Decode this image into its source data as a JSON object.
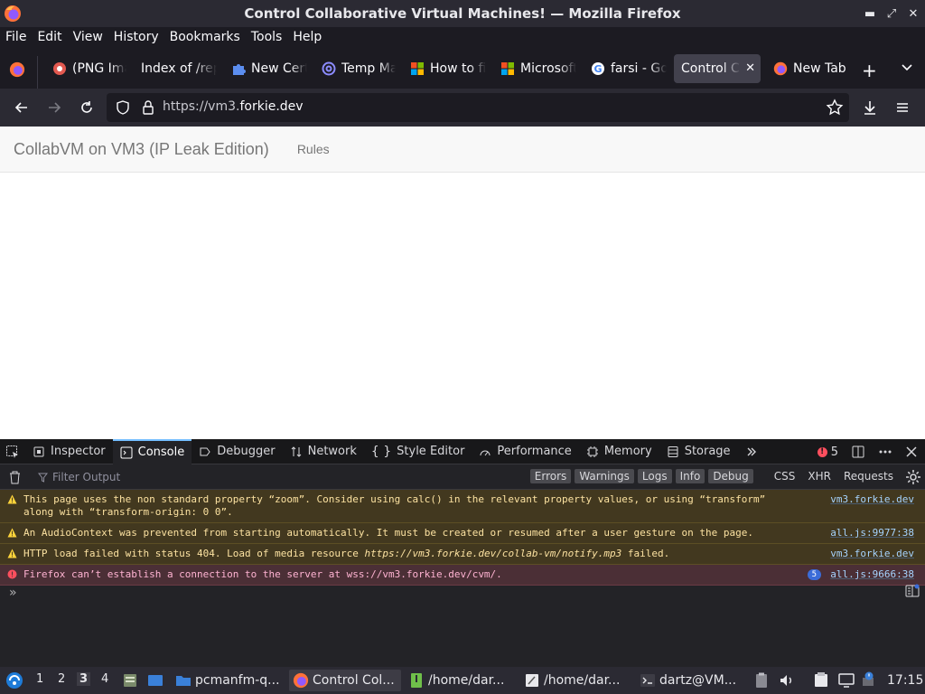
{
  "window": {
    "title": "Control Collaborative Virtual Machines! — Mozilla Firefox"
  },
  "menubar": {
    "items": [
      "File",
      "Edit",
      "View",
      "History",
      "Bookmarks",
      "Tools",
      "Help"
    ]
  },
  "tabs": [
    {
      "label": "(PNG Image",
      "icon": "png-icon"
    },
    {
      "label": "Index of /rep",
      "icon": "none"
    },
    {
      "label": "New Certificate",
      "icon": "puzzle-icon"
    },
    {
      "label": "Temp Mail",
      "icon": "at-icon"
    },
    {
      "label": "How to fix",
      "icon": "windows-icon"
    },
    {
      "label": "Microsoft",
      "icon": "microsoft-icon"
    },
    {
      "label": "farsi - Google",
      "icon": "google-icon"
    },
    {
      "label": "Control Collaborative",
      "icon": "none",
      "active": true
    },
    {
      "label": "New Tab",
      "icon": "firefox-icon"
    }
  ],
  "navbar": {
    "url_prefix": "https://vm3.",
    "url_domain": "forkie.dev"
  },
  "page": {
    "brand": "CollabVM on VM3 (IP Leak Edition)",
    "nav_rules": "Rules"
  },
  "devtools": {
    "tabs": [
      "Inspector",
      "Console",
      "Debugger",
      "Network",
      "Style Editor",
      "Performance",
      "Memory",
      "Storage"
    ],
    "active_tab": "Console",
    "error_count": "5",
    "filter_placeholder": "Filter Output",
    "filters": [
      "Errors",
      "Warnings",
      "Logs",
      "Info",
      "Debug"
    ],
    "filters_extra": [
      "CSS",
      "XHR",
      "Requests"
    ],
    "messages": [
      {
        "level": "warning",
        "text": "This page uses the non standard property “zoom”. Consider using calc() in the relevant property values, or using “transform” along with “transform-origin: 0 0”.",
        "source": "vm3.forkie.dev"
      },
      {
        "level": "warning",
        "text": "An AudioContext was prevented from starting automatically. It must be created or resumed after a user gesture on the page.",
        "source": "all.js:9977:38"
      },
      {
        "level": "warning",
        "text_before": "HTTP load failed with status 404. Load of media resource ",
        "text_link": "https://vm3.forkie.dev/collab-vm/notify.mp3",
        "text_after": " failed.",
        "source": "vm3.forkie.dev"
      },
      {
        "level": "error",
        "text": "Firefox can’t establish a connection to the server at wss://vm3.forkie.dev/cvm/.",
        "repeat": "5",
        "source": "all.js:9666:38"
      }
    ],
    "prompt": "»"
  },
  "taskbar": {
    "workspaces": [
      "1",
      "2",
      "3",
      "4"
    ],
    "active_workspace": "3",
    "items": [
      {
        "label": "pcmanfm-q..."
      },
      {
        "label": "Control Col..."
      },
      {
        "label": "/home/dar..."
      },
      {
        "label": "/home/dar..."
      },
      {
        "label": "dartz@VM..."
      }
    ],
    "clock": "17:15"
  }
}
